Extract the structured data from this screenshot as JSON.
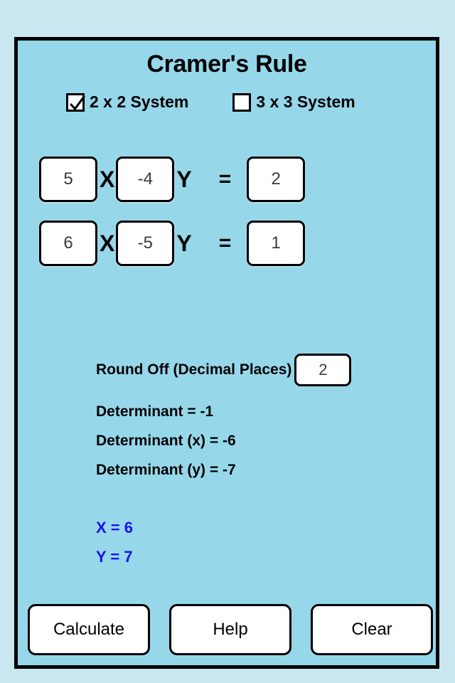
{
  "app": {
    "title": "Cramer's Rule",
    "panel_color": "#97d7ea",
    "page_color": "#c9e7f0",
    "border_color": "#000000",
    "solution_color": "#1414e6"
  },
  "modes": {
    "option_2x2": {
      "label": "2 x 2 System",
      "checked": true,
      "check_glyph": "check-mark"
    },
    "option_3x3": {
      "label": "3 x 3 System",
      "checked": false
    }
  },
  "equations": {
    "row1": {
      "coef_x": "5",
      "var_x": "X",
      "coef_y": "-4",
      "var_y": "Y",
      "equals": "=",
      "constant": "2"
    },
    "row2": {
      "coef_x": "6",
      "var_x": "X",
      "coef_y": "-5",
      "var_y": "Y",
      "equals": "=",
      "constant": "1"
    }
  },
  "round_off": {
    "label": "Round Off (Decimal Places)",
    "value": "2"
  },
  "results": {
    "determinant": "Determinant = -1",
    "determinant_x": "Determinant (x) = -6",
    "determinant_y": "Determinant (y) = -7",
    "solution_x": "X = 6",
    "solution_y": "Y = 7"
  },
  "buttons": {
    "calculate": "Calculate",
    "help": "Help",
    "clear": "Clear"
  }
}
